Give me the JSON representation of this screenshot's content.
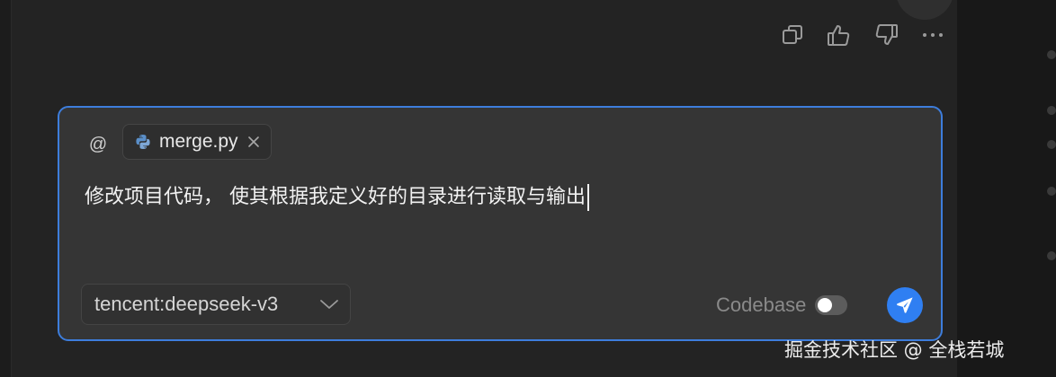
{
  "message_actions": [
    {
      "name": "copy",
      "icon": "copy-icon"
    },
    {
      "name": "like",
      "icon": "thumbs-up-icon"
    },
    {
      "name": "dislike",
      "icon": "thumbs-down-icon"
    },
    {
      "name": "more",
      "icon": "more-horizontal-icon"
    }
  ],
  "composer": {
    "mention_symbol": "@",
    "attachment": {
      "file_name": "merge.py",
      "icon": "python-file-icon",
      "close_icon": "close-icon"
    },
    "prompt_text": "修改项目代码， 使其根据我定义好的目录进行读取与输出",
    "model_selector": {
      "selected": "tencent:deepseek-v3",
      "icon": "chevron-down-icon"
    },
    "codebase_toggle": {
      "label": "Codebase",
      "enabled": false
    },
    "send_icon": "send-icon"
  },
  "watermark": "掘金技术社区 @ 全栈若城",
  "colors": {
    "accent": "#3d7ddc",
    "send_button": "#2f7ff2",
    "background": "#232323",
    "composer_bg": "#353535"
  }
}
